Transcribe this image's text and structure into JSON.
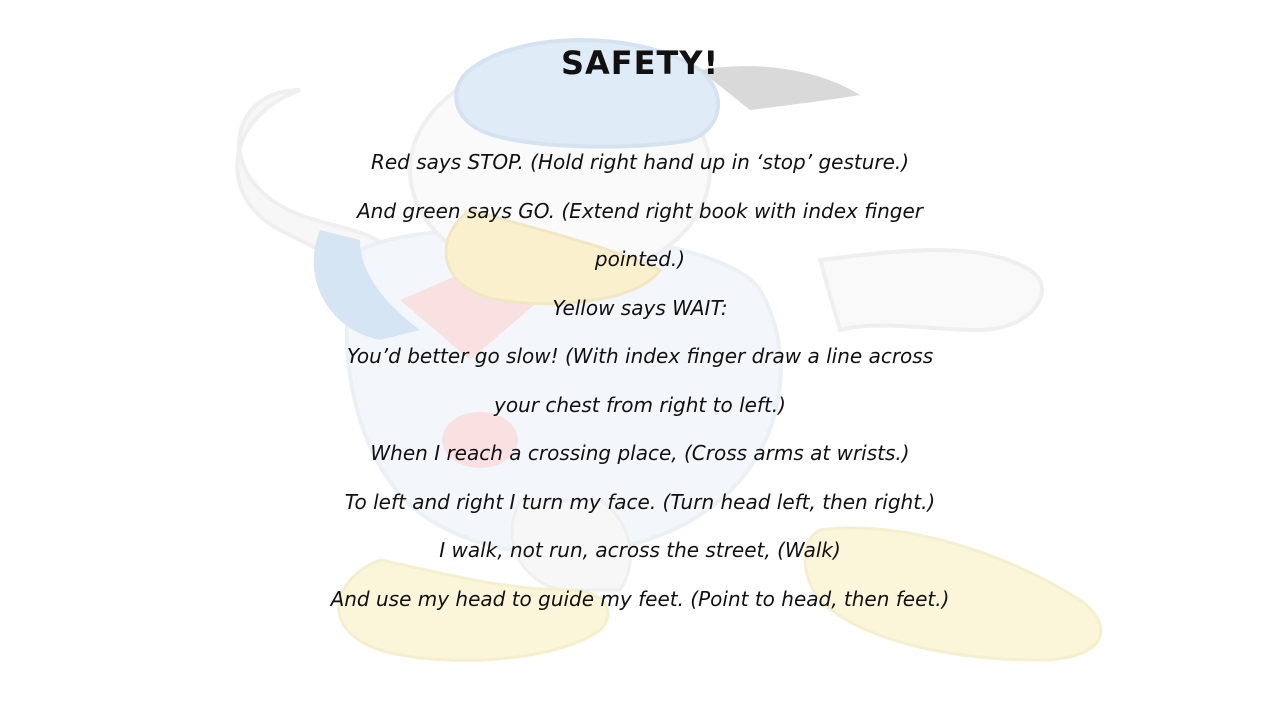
{
  "slide": {
    "title": "SAFETY!",
    "lines": [
      "Red says STOP. (Hold right hand up in ‘stop’ gesture.)",
      "And green says GO. (Extend right book with index finger",
      "pointed.)",
      "Yellow says WAIT:",
      "You’d better go slow! (With index finger draw a line across",
      "your chest from right to left.)",
      "When I reach a crossing place, (Cross arms at wrists.)",
      "To left and right I turn my face. (Turn head left, then right.)",
      "I walk, not run, across the street, (Walk)",
      "And use my head to guide my feet. (Point to head, then feet.)"
    ]
  },
  "colors": {
    "text": "#111111",
    "background": "#ffffff",
    "cap_blue": "#9fc3e8",
    "feet_yellow": "#f3e58a",
    "bill_yellow": "#f3d36a",
    "body_blue": "#7fb0de",
    "cheek_pink": "#f2a3a3"
  },
  "background_art": {
    "icon": "cartoon-duck-watermark"
  }
}
